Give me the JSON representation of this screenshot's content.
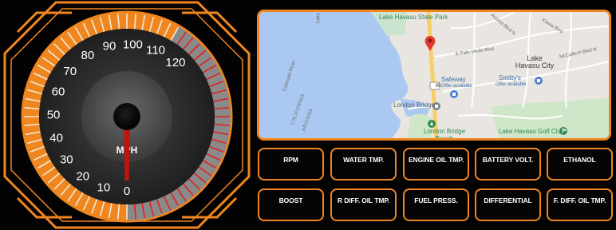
{
  "gauge": {
    "scale_labels": [
      "0",
      "10",
      "20",
      "30",
      "40",
      "50",
      "60",
      "70",
      "80",
      "90",
      "100",
      "110",
      "120"
    ],
    "unit": "MPH",
    "value": 0,
    "max": 130,
    "colors": {
      "accent": "#f0861f",
      "needle": "#c0150f",
      "redline": "#e02020",
      "face": "#2c2c2c"
    }
  },
  "map": {
    "labels": {
      "state_park": "Lake Havasu State Park",
      "lake_havasu_side": "Lake Havasu",
      "city": "Lake Havasu City",
      "colorado_river": "Colorado River",
      "california": "CALIFORNIA",
      "arizona": "ARIZONA",
      "london_bridge": "London Bridge",
      "london_bridge_beach": "London Bridge Beach",
      "safeway": "Safeway",
      "safeway_offer": "Offer available",
      "smittys": "Smitty's",
      "smittys_offer": "Offer available",
      "golf_club": "Lake Havasu Golf Club",
      "street_1": "E Palo Verde Blvd",
      "street_2": "McCulloch Blvd N",
      "street_3": "Acoma Blvd N",
      "street_4": "Kiowa Blvd",
      "route": "95"
    },
    "colors": {
      "water": "#aac8f2",
      "land": "#e9e6e1",
      "highway": "#f6cf6b",
      "park": "#bfe0c6"
    }
  },
  "buttons": [
    {
      "label": "RPM"
    },
    {
      "label": "WATER TMP."
    },
    {
      "label": "ENGINE OIL TMP."
    },
    {
      "label": "BATTERY VOLT."
    },
    {
      "label": "ETHANOL"
    },
    {
      "label": "BOOST"
    },
    {
      "label": "R DIFF. OIL TMP."
    },
    {
      "label": "FUEL PRESS."
    },
    {
      "label": "DIFFERENTIAL"
    },
    {
      "label": "F. DIFF. OIL TMP."
    }
  ]
}
